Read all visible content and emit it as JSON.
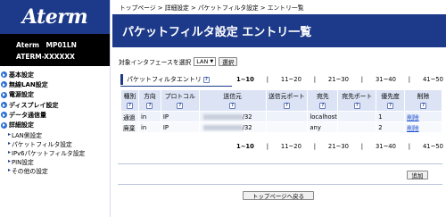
{
  "sidebar": {
    "logo": "Aterm",
    "model_line1": "Aterm　MP01LN",
    "model_line2": "ATERM-XXXXXX",
    "menu": [
      {
        "label": "基本設定"
      },
      {
        "label": "無線LAN設定"
      },
      {
        "label": "電源設定"
      },
      {
        "label": "ディスプレイ設定"
      },
      {
        "label": "データ通信量"
      },
      {
        "label": "詳細設定"
      }
    ],
    "submenu": [
      {
        "label": "LAN側設定"
      },
      {
        "label": "パケットフィルタ設定"
      },
      {
        "label": "IPv6パケットフィルタ設定"
      },
      {
        "label": "PIN設定"
      },
      {
        "label": "その他の設定"
      }
    ]
  },
  "breadcrumb": "トップページ > 詳細設定 > パケットフィルタ設定 > エントリ一覧",
  "title": "パケットフィルタ設定 エントリ一覧",
  "interface": {
    "label": "対象インタフェースを選択",
    "selected": "LAN",
    "button": "選択"
  },
  "entry_section": {
    "title": "パケットフィルタエントリ",
    "help": "?"
  },
  "pager": [
    "1~10",
    "11~20",
    "21~30",
    "31~40",
    "41~50"
  ],
  "table": {
    "columns": [
      "種別",
      "方向",
      "プロトコル",
      "送信元",
      "送信元ポート",
      "宛先",
      "宛先ポート",
      "優先度",
      "削除"
    ],
    "rows": [
      {
        "type": "通過",
        "direction": "in",
        "protocol": "IP",
        "source_suffix": "/32",
        "dest": "localhost",
        "priority": "1",
        "delete": "削除"
      },
      {
        "type": "廃棄",
        "direction": "in",
        "protocol": "IP",
        "source_suffix": "/32",
        "dest": "any",
        "priority": "2",
        "delete": "削除"
      }
    ]
  },
  "add_button": "追加",
  "back_button": "トップページへ戻る"
}
